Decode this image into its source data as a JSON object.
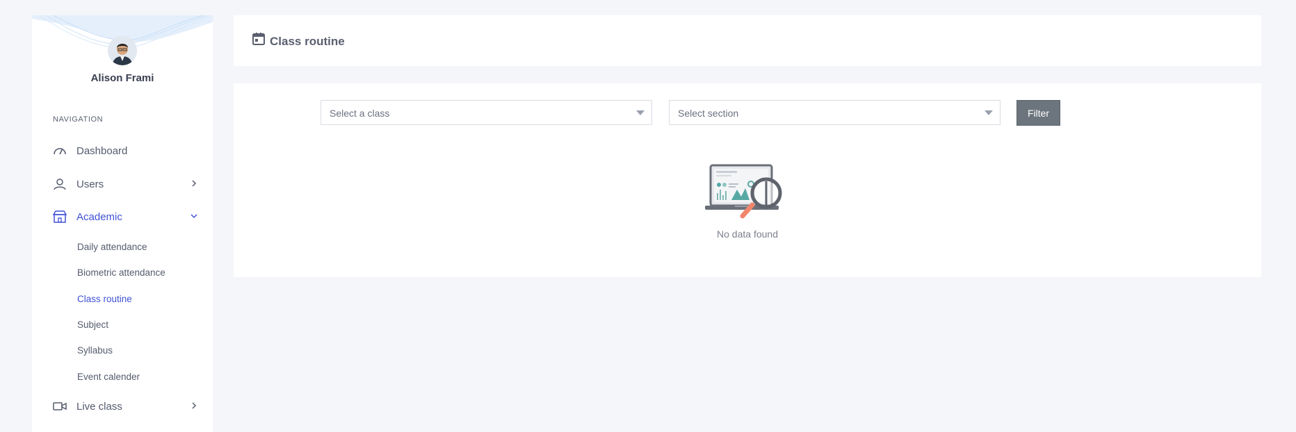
{
  "profile": {
    "name": "Alison Frami"
  },
  "nav": {
    "heading": "NAVIGATION",
    "items": [
      {
        "label": "Dashboard",
        "icon": "dashboard-gauge-icon"
      },
      {
        "label": "Users",
        "icon": "user-icon"
      },
      {
        "label": "Academic",
        "icon": "academic-building-icon"
      },
      {
        "label": "Live class",
        "icon": "video-camera-icon"
      }
    ],
    "academic_sub": [
      {
        "label": "Daily attendance"
      },
      {
        "label": "Biometric attendance"
      },
      {
        "label": "Class routine"
      },
      {
        "label": "Subject"
      },
      {
        "label": "Syllabus"
      },
      {
        "label": "Event calender"
      }
    ]
  },
  "header": {
    "title": "Class routine",
    "icon": "calendar-icon"
  },
  "filters": {
    "class_placeholder": "Select a class",
    "section_placeholder": "Select section",
    "filter_label": "Filter"
  },
  "empty_state": {
    "message": "No data found"
  },
  "colors": {
    "accent": "#3f51d6",
    "background": "#f5f6fa",
    "button": "#6c757d",
    "magnifier_handle": "#f0866b"
  }
}
